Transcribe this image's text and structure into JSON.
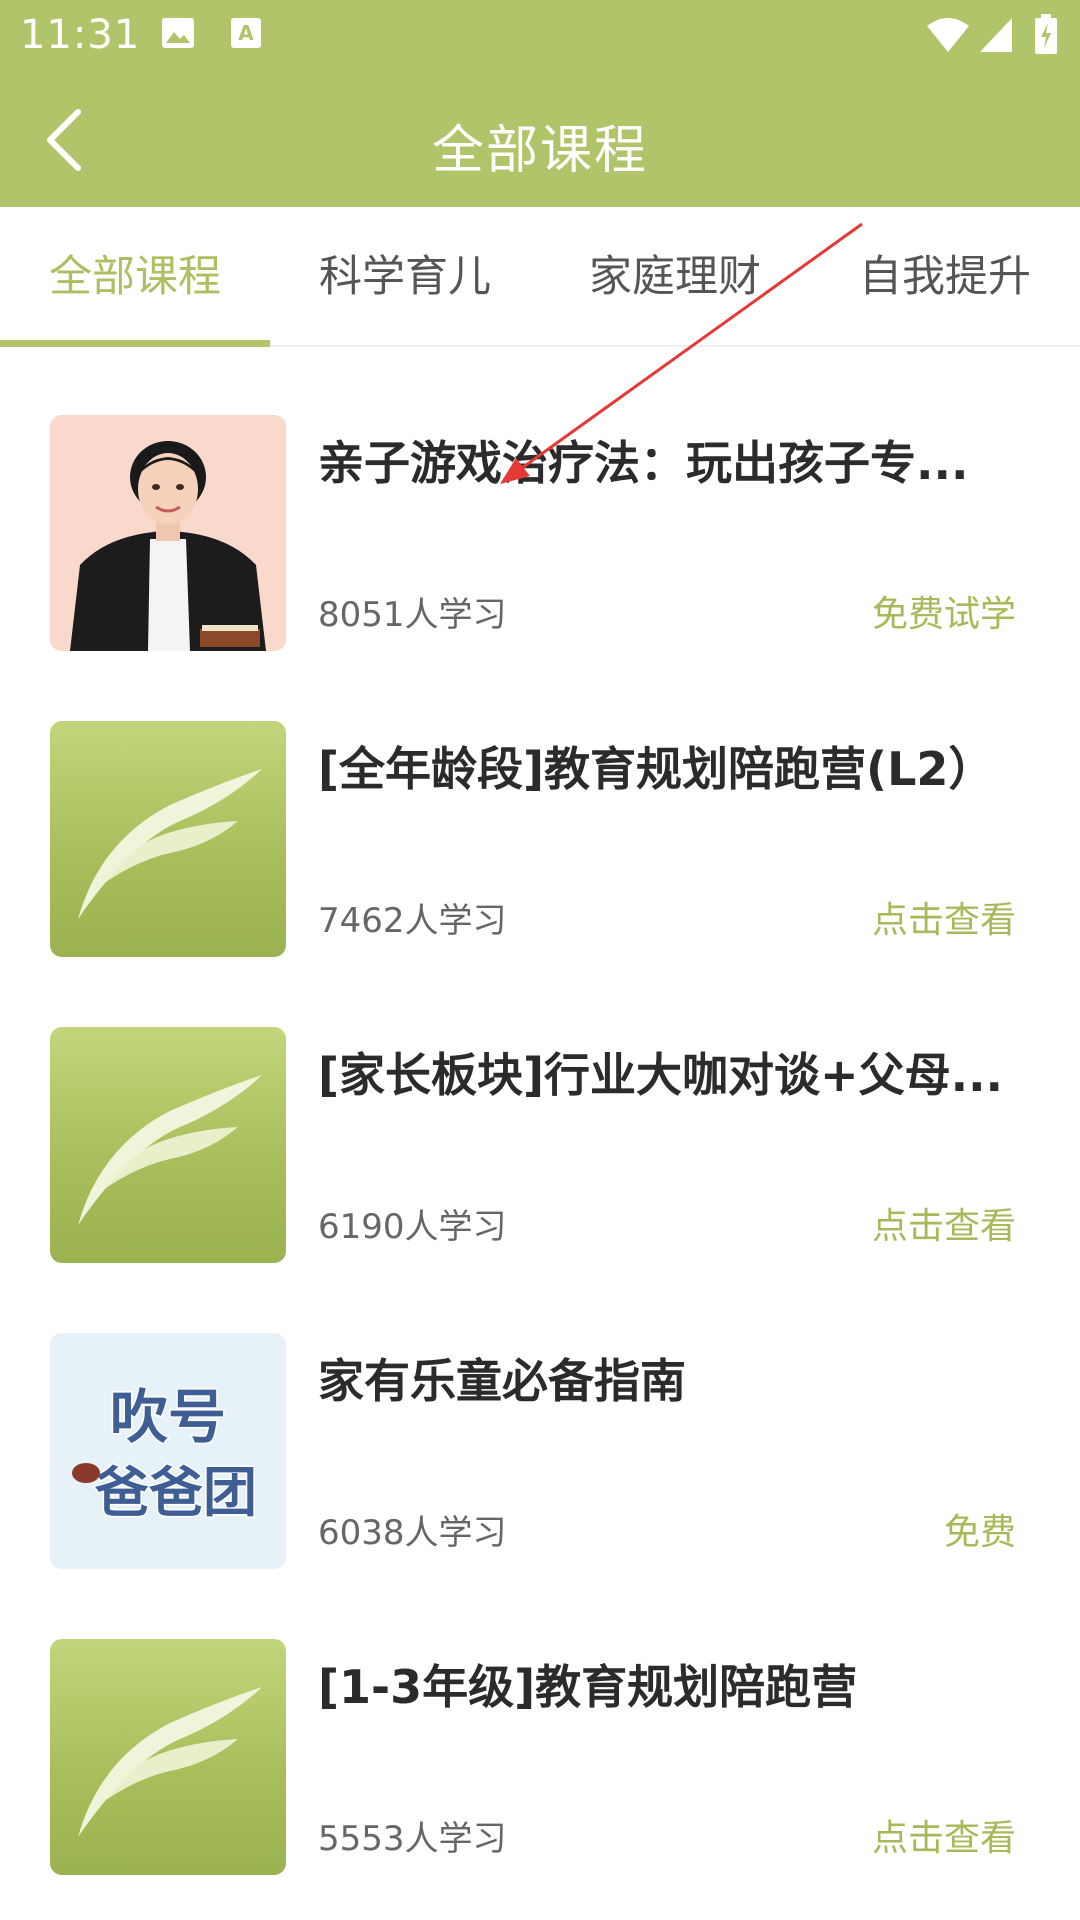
{
  "status_bar": {
    "time": "11:31"
  },
  "header": {
    "title": "全部课程"
  },
  "tabs": [
    {
      "label": "全部课程",
      "active": true
    },
    {
      "label": "科学育儿",
      "active": false
    },
    {
      "label": "家庭理财",
      "active": false
    },
    {
      "label": "自我提升",
      "active": false
    }
  ],
  "courses": [
    {
      "title": "亲子游戏治疗法：玩出孩子专...",
      "learners": "8051人学习",
      "action": "免费试学",
      "thumb": "teacher-portrait"
    },
    {
      "title": "[全年龄段]教育规划陪跑营(L2）",
      "learners": "7462人学习",
      "action": "点击查看",
      "thumb": "leaf-logo"
    },
    {
      "title": "[家长板块]行业大咖对谈+父母...",
      "learners": "6190人学习",
      "action": "点击查看",
      "thumb": "leaf-logo"
    },
    {
      "title": "家有乐童必备指南",
      "learners": "6038人学习",
      "action": "免费",
      "thumb": "blow-horn-dads-logo",
      "thumb_text_line1": "吹号",
      "thumb_text_line2": "爸爸团"
    },
    {
      "title": "[1-3年级]教育规划陪跑营",
      "learners": "5553人学习",
      "action": "点击查看",
      "thumb": "leaf-logo"
    }
  ],
  "colors": {
    "brand": "#b2c46a",
    "accent_text": "#a6ba5a",
    "annotation": "#e53935"
  }
}
